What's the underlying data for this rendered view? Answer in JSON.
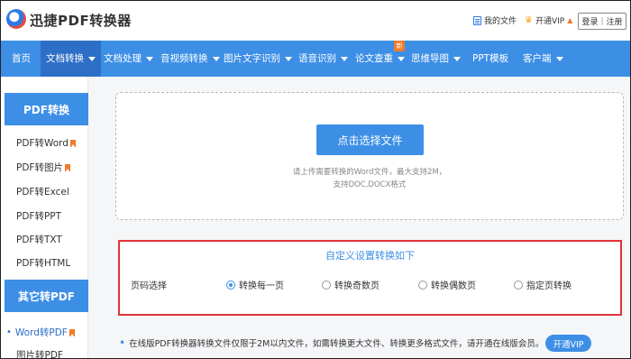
{
  "header": {
    "app_title": "迅捷PDF转换器",
    "my_files": "我的文件",
    "open_vip": "开通VIP",
    "login": "登录",
    "login_separator": "|",
    "register": "注册"
  },
  "nav": {
    "items": [
      {
        "label": "首页",
        "dropdown": false
      },
      {
        "label": "文档转换",
        "dropdown": true,
        "active": true
      },
      {
        "label": "文档处理",
        "dropdown": true
      },
      {
        "label": "音视频转换",
        "dropdown": true
      },
      {
        "label": "图片文字识别",
        "dropdown": true
      },
      {
        "label": "语音识别",
        "dropdown": true
      },
      {
        "label": "论文查重",
        "dropdown": true
      },
      {
        "label": "思维导图",
        "dropdown": true
      },
      {
        "label": "PPT模板",
        "dropdown": false
      },
      {
        "label": "客户端",
        "dropdown": true
      }
    ],
    "new_badge": "新"
  },
  "sidebar": {
    "section1_title": "PDF转换",
    "section1_items": [
      "PDF转Word",
      "PDF转图片",
      "PDF转Excel",
      "PDF转PPT",
      "PDF转TXT",
      "PDF转HTML"
    ],
    "section2_title": "其它转PDF",
    "section2_items": [
      "Word转PDF",
      "图片转PDF"
    ]
  },
  "upload": {
    "button": "点击选择文件",
    "hint_line1": "请上传需要转换的Word文件，最大支持2M，",
    "hint_line2": "支持DOC,DOCX格式"
  },
  "settings": {
    "title": "自定义设置转换如下",
    "page_label": "页码选择",
    "options": [
      "转换每一页",
      "转换奇数页",
      "转换偶数页",
      "指定页转换"
    ],
    "selected_option": "转换每一页"
  },
  "notice": {
    "text": "在线版PDF转换器转换文件仅限于2M以内文件，如需转换更大文件、转换更多格式文件，请开通在线版会员。",
    "vip_button": "开通VIP"
  },
  "colors": {
    "nav_blue": "#3d8fe6",
    "nav_active": "#2d6fc7",
    "highlight_red": "#e2323a",
    "badge_orange": "#f07b2a"
  }
}
